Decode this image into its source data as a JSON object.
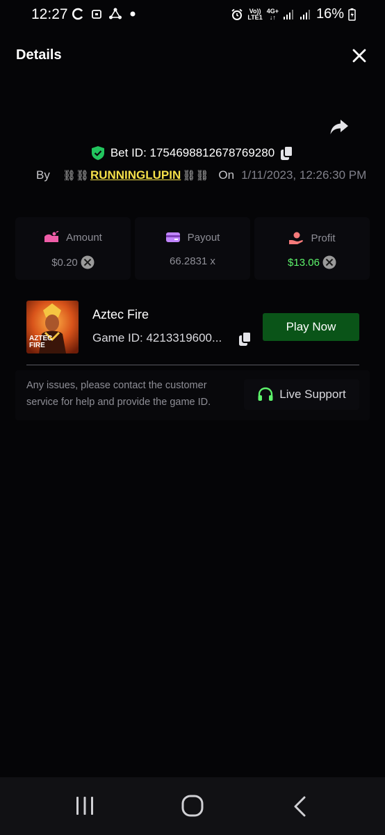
{
  "status_bar": {
    "time": "12:27",
    "network_top": "Vo))",
    "network_bottom": "LTE1",
    "net_type": "4G+",
    "battery": "16%"
  },
  "header": {
    "title": "Details"
  },
  "bet": {
    "id_text": "Bet ID: 1754698812678769280",
    "by_label": "By",
    "username": "RUNNINGLUPIN",
    "on_label": "On",
    "date": "1/11/2023, 12:26:30 PM"
  },
  "stats": {
    "amount_label": "Amount",
    "amount_value": "$0.20",
    "payout_label": "Payout",
    "payout_value": "66.2831 x",
    "profit_label": "Profit",
    "profit_value": "$13.06"
  },
  "game": {
    "name": "Aztec Fire",
    "id_text": "Game ID: 4213319600...",
    "thumb_line1": "AZTEC",
    "thumb_line2": "FIRE",
    "play_label": "Play Now"
  },
  "support": {
    "text": "Any issues, please contact the customer service for help and provide the game ID.",
    "button_label": "Live Support"
  },
  "colors": {
    "accent_green": "#5df36b",
    "play_button": "#0a5418",
    "username": "#f5e049",
    "shield": "#22c55e"
  }
}
